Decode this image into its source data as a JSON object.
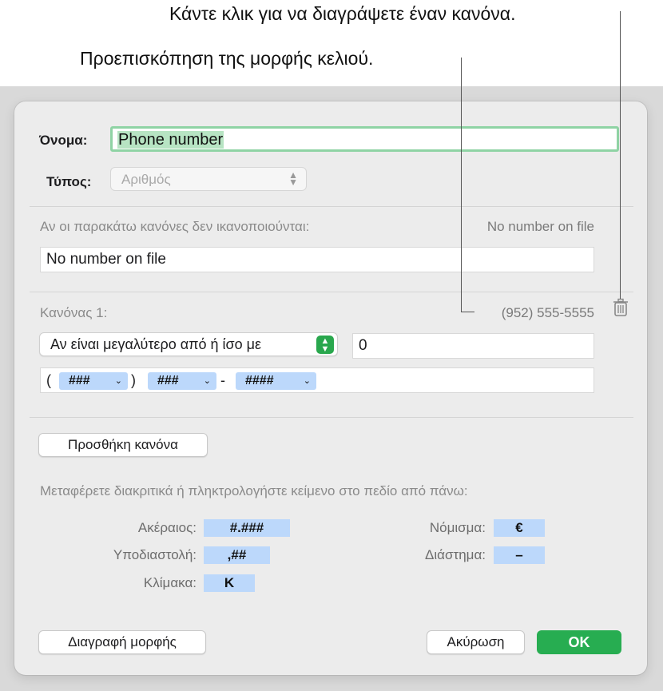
{
  "callouts": {
    "delete_rule": "Κάντε κλικ για να διαγράψετε έναν κανόνα.",
    "preview": "Προεπισκόπηση της μορφής κελιού."
  },
  "dialog": {
    "name_label": "Όνομα:",
    "name_value": "Phone number",
    "type_label": "Τύπος:",
    "type_value": "Αριθμός",
    "fallback_label": "Αν οι παρακάτω κανόνες δεν ικανοποιούνται:",
    "fallback_preview": "No number on file",
    "fallback_value": "No number on file",
    "rule": {
      "title": "Κανόνας 1:",
      "preview": "(952) 555-5555",
      "condition": "Αν είναι μεγαλύτερο από ή ίσο με",
      "threshold": "0",
      "format": {
        "open_paren": "(",
        "token1": "###",
        "close_paren": ")",
        "token2": "###",
        "dash": "-",
        "token3": "####"
      }
    },
    "add_rule_button": "Προσθήκη κανόνα",
    "instructions": "Μεταφέρετε διακριτικά ή πληκτρολογήστε κείμενο στο πεδίο από πάνω:",
    "tokens": {
      "integer_label": "Ακέραιος:",
      "integer_chip": "#.###",
      "decimal_label": "Υποδιαστολή:",
      "decimal_chip": ",##",
      "scale_label": "Κλίμακα:",
      "scale_chip": "K",
      "currency_label": "Νόμισμα:",
      "currency_chip": "€",
      "space_label": "Διάστημα:",
      "space_chip": "–"
    },
    "delete_format_button": "Διαγραφή μορφής",
    "cancel_button": "Ακύρωση",
    "ok_button": "OK"
  },
  "colors": {
    "accent_green": "#27ad51",
    "token_blue": "#bcd8fb",
    "field_focus": "#8fd3a4"
  }
}
